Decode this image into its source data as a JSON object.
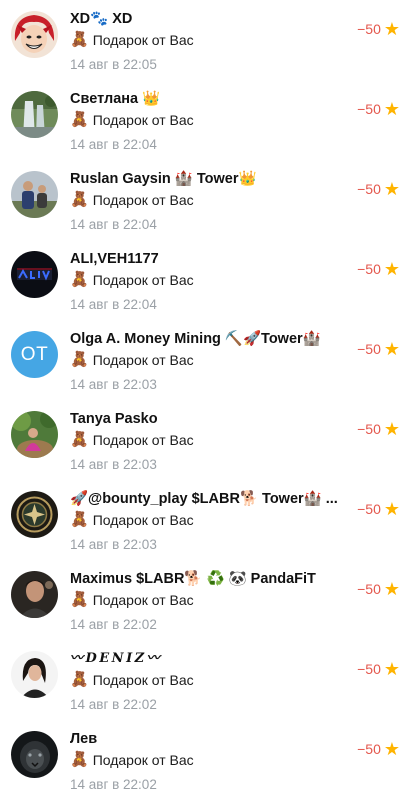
{
  "colors": {
    "amount": "#e4574d",
    "star": "#ffb400",
    "time": "#9aa0a6",
    "initials_bg": "#45a6e4"
  },
  "transactions": [
    {
      "name": "XD🐾 XD",
      "avatar": "anime-red-hair",
      "subtitle": "Подарок от Вас",
      "gift_icon": "🧸",
      "time": "14 авг в 22:05",
      "amount": "−50",
      "star_icon": "★"
    },
    {
      "name": "Светлана 👑",
      "avatar": "waterfall-photo",
      "subtitle": "Подарок от Вас",
      "gift_icon": "🧸",
      "time": "14 авг в 22:04",
      "amount": "−50",
      "star_icon": "★"
    },
    {
      "name": "Ruslan Gaysin 🏰 Tower👑",
      "avatar": "people-photo",
      "subtitle": "Подарок от Вас",
      "gift_icon": "🧸",
      "time": "14 авг в 22:04",
      "amount": "−50",
      "star_icon": "★"
    },
    {
      "name": "ALI,VEH1177",
      "avatar": "dark-neon-logo",
      "subtitle": "Подарок от Вас",
      "gift_icon": "🧸",
      "time": "14 авг в 22:04",
      "amount": "−50",
      "star_icon": "★"
    },
    {
      "name": "Olga A. Money Mining ⛏️🚀Tower🏰",
      "avatar_initials": "OT",
      "subtitle": "Подарок от Вас",
      "gift_icon": "🧸",
      "time": "14 авг в 22:03",
      "amount": "−50",
      "star_icon": "★"
    },
    {
      "name": "Tanya Pasko",
      "avatar": "garden-photo",
      "subtitle": "Подарок от Вас",
      "gift_icon": "🧸",
      "time": "14 авг в 22:03",
      "amount": "−50",
      "star_icon": "★"
    },
    {
      "name": "🚀@bounty_play $LABR🐕 Tower🏰 ...",
      "avatar": "emblem-badge",
      "subtitle": "Подарок от Вас",
      "gift_icon": "🧸",
      "time": "14 авг в 22:03",
      "amount": "−50",
      "star_icon": "★"
    },
    {
      "name": "Maximus $LABR🐕 ♻️ 🐼 PandaFiT",
      "avatar": "man-portrait",
      "subtitle": "Подарок от Вас",
      "gift_icon": "🧸",
      "time": "14 авг в 22:02",
      "amount": "−50",
      "star_icon": "★"
    },
    {
      "name": "〰𝑫𝑬𝑵𝑰𝒁〰",
      "avatar": "woman-portrait",
      "subtitle": "Подарок от Вас",
      "gift_icon": "🧸",
      "time": "14 авг в 22:02",
      "amount": "−50",
      "star_icon": "★"
    },
    {
      "name": "Лев",
      "avatar": "lion-photo",
      "subtitle": "Подарок от Вас",
      "gift_icon": "🧸",
      "time": "14 авг в 22:02",
      "amount": "−50",
      "star_icon": "★"
    }
  ]
}
